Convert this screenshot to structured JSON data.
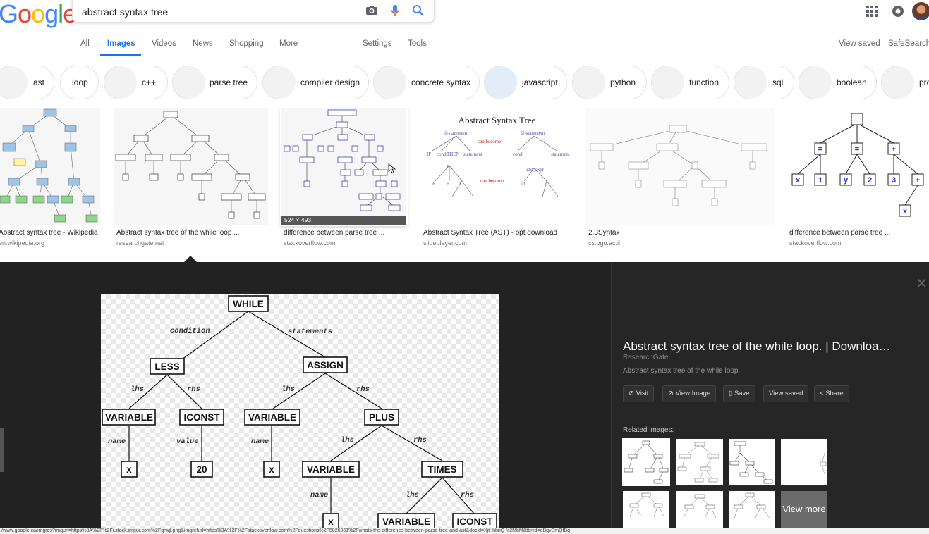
{
  "logo": {
    "letters": [
      "G",
      "o",
      "o",
      "g",
      "l",
      "e"
    ],
    "colors": [
      "#4285f4",
      "#ea4335",
      "#fbbc05",
      "#4285f4",
      "#34a853",
      "#ea4335"
    ]
  },
  "search": {
    "query": "abstract syntax tree"
  },
  "icons": {
    "camera": "camera-icon",
    "mic": "mic-icon",
    "search": "search-icon",
    "apps": "apps-grid-icon",
    "notifications": "notifications-icon"
  },
  "tabs": {
    "all": "All",
    "images": "Images",
    "videos": "Videos",
    "news": "News",
    "shopping": "Shopping",
    "more": "More",
    "settings": "Settings",
    "tools": "Tools",
    "view_saved": "View saved",
    "safesearch": "SafeSearch"
  },
  "chips": [
    "ast",
    "loop",
    "c++",
    "parse tree",
    "compiler design",
    "concrete syntax",
    "javascript",
    "python",
    "function",
    "sql",
    "boolean",
    "pro"
  ],
  "results": [
    {
      "title": "Abstract syntax tree - Wikipedia",
      "source": "en.wikipedia.org"
    },
    {
      "title": "Abstract syntax tree of the while loop ...",
      "source": "researchgate.net"
    },
    {
      "title": "difference between parse tree ...",
      "source": "stackoverflow.com",
      "dimensions": "524 × 493"
    },
    {
      "title": "Abstract Syntax Tree (AST) - ppt download",
      "source": "slideplayer.com",
      "image_heading": "Abstract Syntax Tree"
    },
    {
      "title": "2.3Syntax",
      "source": "cs.bgu.ac.il"
    },
    {
      "title": "difference between parse tree ...",
      "source": "stackoverflow.com"
    }
  ],
  "thumb6": {
    "n1": "=",
    "n2": "=",
    "n3": "+",
    "x": "x",
    "one": "1",
    "y": "y",
    "two": "2",
    "three": "3",
    "plus": "+",
    "x2": "x"
  },
  "big_tree": {
    "while": "WHILE",
    "condition": "condition",
    "statements": "statements",
    "less": "LESS",
    "assign": "ASSIGN",
    "lhs": "lhs",
    "rhs": "rhs",
    "variable": "VARIABLE",
    "iconst": "ICONST",
    "plus": "PLUS",
    "times": "TIMES",
    "name": "name",
    "value": "value",
    "x": "x",
    "twenty": "20"
  },
  "preview": {
    "title": "Abstract syntax tree of the while loop. | Downloa…",
    "site": "ResearchGate",
    "description": "Abstract syntax tree of the while loop.",
    "buttons": {
      "visit": "Visit",
      "view_image": "View Image",
      "save": "Save",
      "view_saved": "View saved",
      "share": "Share"
    },
    "related_label": "Related images:",
    "view_more": "View more"
  },
  "status_bar": "/www.google.ca/imgres?imgurl=https%3A%2F%2Fi.stack.imgur.com%2Fqrwjl.png&imgrefurl=https%3A%2F%2Fstackoverflow.com%2Fquestions%2F5026961%2Fwhats-the-difference-between-parse-tree-and-ast&docid=Xjt_hbnQ-Y2MbM&tbnid=eBqvEmQfBq"
}
